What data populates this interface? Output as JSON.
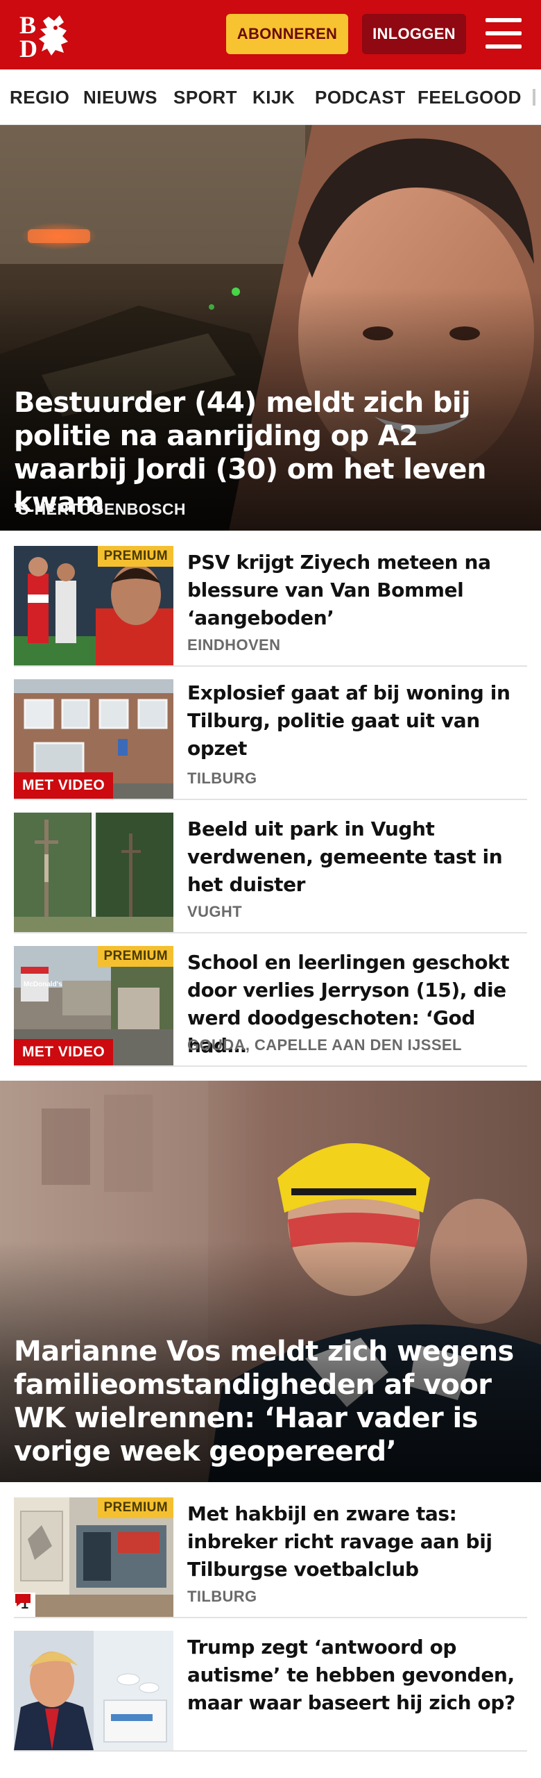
{
  "header": {
    "logo_letters": "BD",
    "subscribe_label": "ABONNEREN",
    "login_label": "INLOGGEN",
    "colors": {
      "brand_red": "#cc0a0f",
      "subscribe_yellow": "#f7c331",
      "login_dark": "#8f0812"
    }
  },
  "nav": {
    "items": [
      "REGIO",
      "NIEUWS",
      "SPORT",
      "KIJK",
      "PODCAST",
      "FEELGOOD"
    ]
  },
  "hero1": {
    "title": "Bestuurder (44) meldt zich bij politie na aanrijding op A2 waarbij Jordi (30) om het leven kwam",
    "location": "'S-HERTOGENBOSCH"
  },
  "articles": [
    {
      "title": "PSV krijgt Ziyech meteen na blessure van Van Bommel ‘aangeboden’",
      "location": "EINDHOVEN",
      "premium": "PREMIUM",
      "thumb_icon": "football-players-image"
    },
    {
      "title": "Explosief gaat af bij woning in Tilburg, politie gaat uit van opzet",
      "location": "TILBURG",
      "video": "MET VIDEO",
      "thumb_icon": "house-facade-image"
    },
    {
      "title": "Beeld uit park in Vught verdwenen, gemeente tast in het duister",
      "location": "VUGHT",
      "thumb_icon": "park-statue-image"
    },
    {
      "title": "School en leerlingen geschokt door verlies Jerryson (15), die werd doodgeschoten: ‘God had…",
      "location": "GOUDA, CAPELLE AAN DEN IJSSEL",
      "premium": "PREMIUM",
      "video": "MET VIDEO",
      "thumb_icon": "street-scene-image"
    }
  ],
  "hero2": {
    "title": "Marianne Vos meldt zich wegens familieomstandigheden af voor WK wielrennen: ‘Haar vader is vorige week geopereerd’"
  },
  "articles2": [
    {
      "title": "Met hakbijl en zware tas: inbreker richt ravage aan bij Tilburgse voetbalclub",
      "location": "TILBURG",
      "premium": "PREMIUM",
      "comments": "1",
      "thumb_icon": "clubhouse-image"
    },
    {
      "title": "Trump zegt ‘antwoord op autisme’ te hebben gevonden, maar waar baseert hij zich op?",
      "location": "",
      "thumb_icon": "politician-pills-image"
    }
  ]
}
